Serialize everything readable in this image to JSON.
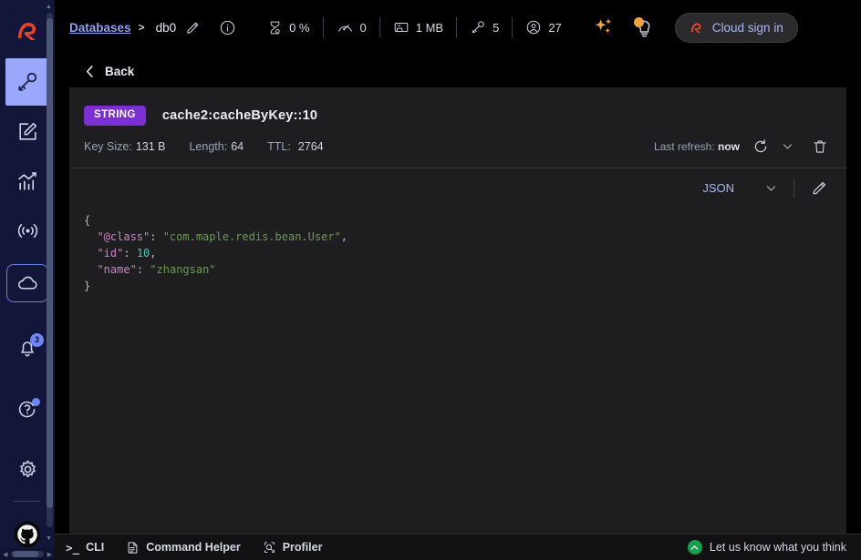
{
  "sidebar": {
    "logo_icon": "redis-logo-icon",
    "items": [
      {
        "name": "browse",
        "icon": "key-icon",
        "active": true
      },
      {
        "name": "workbench",
        "icon": "edit-square-icon",
        "active": false
      },
      {
        "name": "analysis",
        "icon": "bar-chart-icon",
        "active": false
      },
      {
        "name": "pubsub",
        "icon": "broadcast-icon",
        "active": false
      },
      {
        "name": "cloud",
        "icon": "cloud-icon",
        "active": false,
        "boxed": true
      }
    ],
    "notifications": {
      "icon": "bell-icon",
      "badge": "3"
    },
    "help": {
      "icon": "question-circle-icon",
      "dot": true
    },
    "settings": {
      "icon": "gear-icon"
    },
    "github": {
      "icon": "github-icon"
    }
  },
  "topbar": {
    "breadcrumb_link": "Databases",
    "breadcrumb_separator": ">",
    "db_name": "db0",
    "edit_icon": "pencil-icon",
    "info_icon": "info-circle-icon",
    "stats": [
      {
        "icon": "hourglass-icon",
        "value": "0 %"
      },
      {
        "icon": "gauge-icon",
        "value": "0"
      },
      {
        "icon": "memory-card-icon",
        "value": "1 MB"
      },
      {
        "icon": "key-icon",
        "value": "5"
      },
      {
        "icon": "user-circle-icon",
        "value": "27"
      }
    ],
    "copilot_icon": "sparkles-icon",
    "tips_icon": "lightbulb-icon",
    "cloud_signin_label": "Cloud sign in",
    "cloud_signin_icon": "redis-logo-icon",
    "accent_blue": "#8fa0f5",
    "accent_orange": "#f2a33c",
    "accent_red": "#f0402a"
  },
  "back": {
    "label": "Back",
    "icon": "chevron-left-icon"
  },
  "key": {
    "type_badge": "STRING",
    "badge_color": "#7b2fd4",
    "name": "cache2:cacheByKey::10",
    "meta": [
      {
        "label": "Key Size:",
        "value": "131 B"
      },
      {
        "label": "Length:",
        "value": "64"
      },
      {
        "label": "TTL:",
        "value": "2764"
      }
    ],
    "last_refresh_label": "Last refresh:",
    "last_refresh_value": "now",
    "refresh_icon": "refresh-icon",
    "refresh_chevron_icon": "chevron-down-icon",
    "delete_icon": "trash-icon"
  },
  "viewer": {
    "format": "JSON",
    "format_chevron_icon": "chevron-down-icon",
    "edit_icon": "pencil-icon",
    "lines": [
      [
        {
          "t": "brace",
          "s": "{"
        }
      ],
      [
        {
          "t": "punc",
          "s": "  "
        },
        {
          "t": "key",
          "s": "\"@class\""
        },
        {
          "t": "punc",
          "s": ": "
        },
        {
          "t": "str",
          "s": "\"com.maple.redis.bean.User\""
        },
        {
          "t": "punc",
          "s": ","
        }
      ],
      [
        {
          "t": "punc",
          "s": "  "
        },
        {
          "t": "key",
          "s": "\"id\""
        },
        {
          "t": "punc",
          "s": ": "
        },
        {
          "t": "num",
          "s": "10"
        },
        {
          "t": "punc",
          "s": ","
        }
      ],
      [
        {
          "t": "punc",
          "s": "  "
        },
        {
          "t": "key",
          "s": "\"name\""
        },
        {
          "t": "punc",
          "s": ": "
        },
        {
          "t": "str",
          "s": "\"zhangsan\""
        }
      ],
      [
        {
          "t": "brace",
          "s": "}"
        }
      ]
    ]
  },
  "bottombar": {
    "cli_label": "CLI",
    "cli_icon": "terminal-icon",
    "command_helper_label": "Command Helper",
    "command_helper_icon": "document-icon",
    "profiler_label": "Profiler",
    "profiler_icon": "magnifier-icon",
    "feedback_label": "Let us know what you think",
    "feedback_icon": "feedback-icon"
  }
}
